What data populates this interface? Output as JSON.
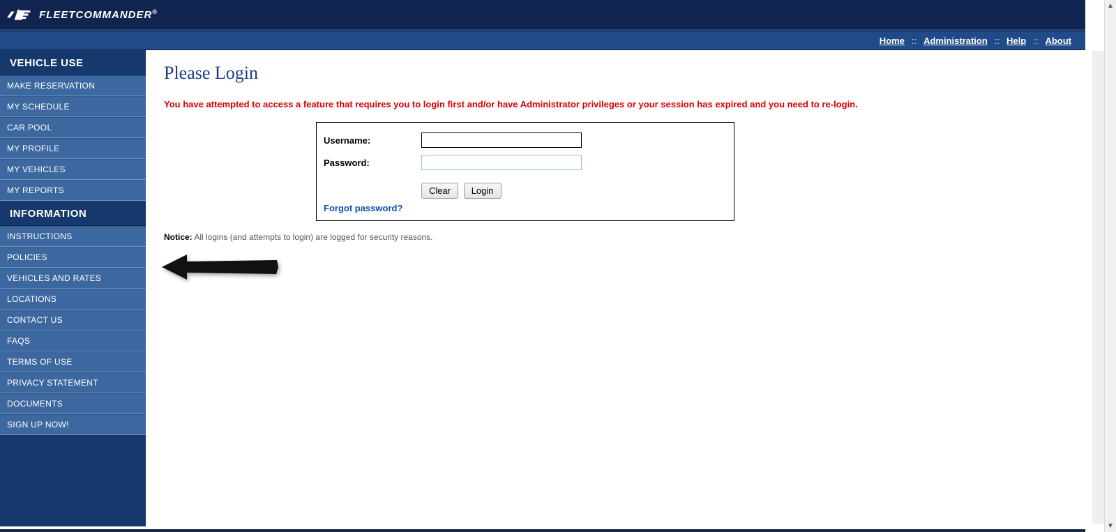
{
  "brand": {
    "name": "FLEETCOMMANDER",
    "trademark": "®"
  },
  "topnav": {
    "home": "Home",
    "administration": "Administration",
    "help": "Help",
    "about": "About",
    "sep": "::"
  },
  "sidebar": {
    "section1_title": "VEHICLE USE",
    "section1_items": [
      "MAKE RESERVATION",
      "MY SCHEDULE",
      "CAR POOL",
      "MY PROFILE",
      "MY VEHICLES",
      "MY REPORTS"
    ],
    "section2_title": "INFORMATION",
    "section2_items": [
      "INSTRUCTIONS",
      "POLICIES",
      "VEHICLES AND RATES",
      "LOCATIONS",
      "CONTACT US",
      "FAQS",
      "TERMS OF USE",
      "PRIVACY STATEMENT",
      "DOCUMENTS",
      "SIGN UP NOW!"
    ]
  },
  "main": {
    "title": "Please Login",
    "error": "You have attempted to access a feature that requires you to login first and/or have Administrator privileges or your session has expired and you need to re-login.",
    "username_label": "Username:",
    "password_label": "Password:",
    "clear_btn": "Clear",
    "login_btn": "Login",
    "forgot": "Forgot password?",
    "notice_label": "Notice:",
    "notice_text": " All logins (and attempts to login) are logged for security reasons."
  }
}
